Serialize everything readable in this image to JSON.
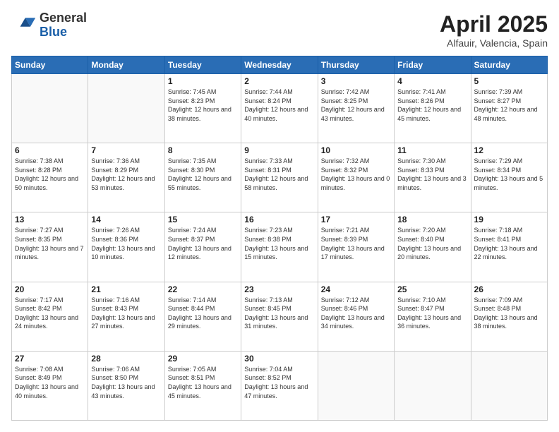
{
  "header": {
    "logo_general": "General",
    "logo_blue": "Blue",
    "title": "April 2025",
    "subtitle": "Alfauir, Valencia, Spain"
  },
  "days_of_week": [
    "Sunday",
    "Monday",
    "Tuesday",
    "Wednesday",
    "Thursday",
    "Friday",
    "Saturday"
  ],
  "weeks": [
    [
      {
        "day": "",
        "info": ""
      },
      {
        "day": "",
        "info": ""
      },
      {
        "day": "1",
        "info": "Sunrise: 7:45 AM\nSunset: 8:23 PM\nDaylight: 12 hours and 38 minutes."
      },
      {
        "day": "2",
        "info": "Sunrise: 7:44 AM\nSunset: 8:24 PM\nDaylight: 12 hours and 40 minutes."
      },
      {
        "day": "3",
        "info": "Sunrise: 7:42 AM\nSunset: 8:25 PM\nDaylight: 12 hours and 43 minutes."
      },
      {
        "day": "4",
        "info": "Sunrise: 7:41 AM\nSunset: 8:26 PM\nDaylight: 12 hours and 45 minutes."
      },
      {
        "day": "5",
        "info": "Sunrise: 7:39 AM\nSunset: 8:27 PM\nDaylight: 12 hours and 48 minutes."
      }
    ],
    [
      {
        "day": "6",
        "info": "Sunrise: 7:38 AM\nSunset: 8:28 PM\nDaylight: 12 hours and 50 minutes."
      },
      {
        "day": "7",
        "info": "Sunrise: 7:36 AM\nSunset: 8:29 PM\nDaylight: 12 hours and 53 minutes."
      },
      {
        "day": "8",
        "info": "Sunrise: 7:35 AM\nSunset: 8:30 PM\nDaylight: 12 hours and 55 minutes."
      },
      {
        "day": "9",
        "info": "Sunrise: 7:33 AM\nSunset: 8:31 PM\nDaylight: 12 hours and 58 minutes."
      },
      {
        "day": "10",
        "info": "Sunrise: 7:32 AM\nSunset: 8:32 PM\nDaylight: 13 hours and 0 minutes."
      },
      {
        "day": "11",
        "info": "Sunrise: 7:30 AM\nSunset: 8:33 PM\nDaylight: 13 hours and 3 minutes."
      },
      {
        "day": "12",
        "info": "Sunrise: 7:29 AM\nSunset: 8:34 PM\nDaylight: 13 hours and 5 minutes."
      }
    ],
    [
      {
        "day": "13",
        "info": "Sunrise: 7:27 AM\nSunset: 8:35 PM\nDaylight: 13 hours and 7 minutes."
      },
      {
        "day": "14",
        "info": "Sunrise: 7:26 AM\nSunset: 8:36 PM\nDaylight: 13 hours and 10 minutes."
      },
      {
        "day": "15",
        "info": "Sunrise: 7:24 AM\nSunset: 8:37 PM\nDaylight: 13 hours and 12 minutes."
      },
      {
        "day": "16",
        "info": "Sunrise: 7:23 AM\nSunset: 8:38 PM\nDaylight: 13 hours and 15 minutes."
      },
      {
        "day": "17",
        "info": "Sunrise: 7:21 AM\nSunset: 8:39 PM\nDaylight: 13 hours and 17 minutes."
      },
      {
        "day": "18",
        "info": "Sunrise: 7:20 AM\nSunset: 8:40 PM\nDaylight: 13 hours and 20 minutes."
      },
      {
        "day": "19",
        "info": "Sunrise: 7:18 AM\nSunset: 8:41 PM\nDaylight: 13 hours and 22 minutes."
      }
    ],
    [
      {
        "day": "20",
        "info": "Sunrise: 7:17 AM\nSunset: 8:42 PM\nDaylight: 13 hours and 24 minutes."
      },
      {
        "day": "21",
        "info": "Sunrise: 7:16 AM\nSunset: 8:43 PM\nDaylight: 13 hours and 27 minutes."
      },
      {
        "day": "22",
        "info": "Sunrise: 7:14 AM\nSunset: 8:44 PM\nDaylight: 13 hours and 29 minutes."
      },
      {
        "day": "23",
        "info": "Sunrise: 7:13 AM\nSunset: 8:45 PM\nDaylight: 13 hours and 31 minutes."
      },
      {
        "day": "24",
        "info": "Sunrise: 7:12 AM\nSunset: 8:46 PM\nDaylight: 13 hours and 34 minutes."
      },
      {
        "day": "25",
        "info": "Sunrise: 7:10 AM\nSunset: 8:47 PM\nDaylight: 13 hours and 36 minutes."
      },
      {
        "day": "26",
        "info": "Sunrise: 7:09 AM\nSunset: 8:48 PM\nDaylight: 13 hours and 38 minutes."
      }
    ],
    [
      {
        "day": "27",
        "info": "Sunrise: 7:08 AM\nSunset: 8:49 PM\nDaylight: 13 hours and 40 minutes."
      },
      {
        "day": "28",
        "info": "Sunrise: 7:06 AM\nSunset: 8:50 PM\nDaylight: 13 hours and 43 minutes."
      },
      {
        "day": "29",
        "info": "Sunrise: 7:05 AM\nSunset: 8:51 PM\nDaylight: 13 hours and 45 minutes."
      },
      {
        "day": "30",
        "info": "Sunrise: 7:04 AM\nSunset: 8:52 PM\nDaylight: 13 hours and 47 minutes."
      },
      {
        "day": "",
        "info": ""
      },
      {
        "day": "",
        "info": ""
      },
      {
        "day": "",
        "info": ""
      }
    ]
  ]
}
